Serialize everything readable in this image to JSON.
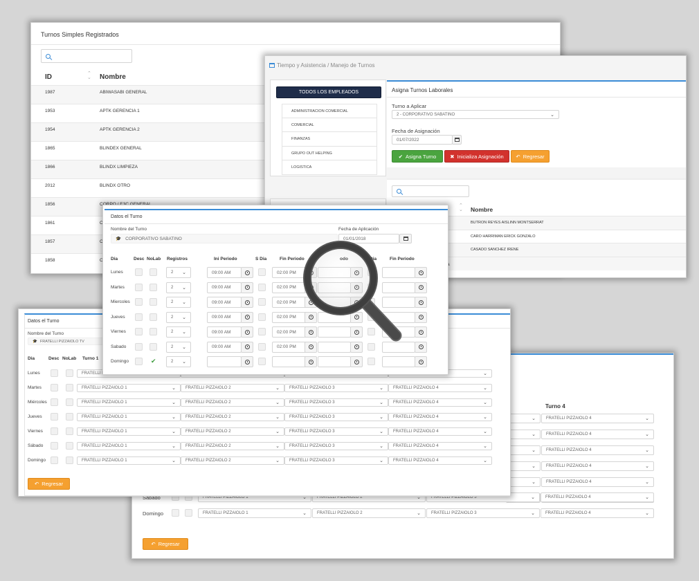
{
  "shifts_list": {
    "title": "Turnos Simples Registrados",
    "columns": {
      "id": "ID",
      "name": "Nombre"
    },
    "rows": [
      {
        "id": "1987",
        "name": "ABIWASABI GENERAL"
      },
      {
        "id": "1953",
        "name": "APTK GERENCIA 1"
      },
      {
        "id": "1954",
        "name": "APTK GERENCIA 2"
      },
      {
        "id": "1865",
        "name": "BLINDEX GENERAL"
      },
      {
        "id": "1866",
        "name": "BLINDX LIMPIEZA"
      },
      {
        "id": "2012",
        "name": "BLINDX OTRO"
      },
      {
        "id": "1856",
        "name": "CORPO / E3C GENERAL"
      },
      {
        "id": "1861",
        "name": "C"
      },
      {
        "id": "1857",
        "name": "C"
      },
      {
        "id": "1858",
        "name": "C"
      }
    ]
  },
  "assign": {
    "breadcrumb": "Tiempo y Asistencia / Manejo de Turnos",
    "all_employees": "TODOS LOS EMPLEADOS",
    "departments": [
      "ADMINISTRACION COMERCIAL",
      "COMERCIAL",
      "FINANZAS",
      "GRUPO OUT HELPING",
      "LOGISTICA"
    ],
    "panel_title": "Asigna Turnos Laborales",
    "turno_label": "Turno a Aplicar",
    "turno_value": "2 - CORPORATIVO SABATINO",
    "fecha_label": "Fecha de Asignación",
    "fecha_value": "01/07/2022",
    "btn_assign": "Asigna Turno",
    "btn_init": "Inicializa Asignación",
    "btn_back": "Regresar",
    "emp_column": "Nombre",
    "employees": [
      "BUTRON REYES AISLINN MONTSERRAT",
      "CARO HARRIMAN ERICK GONZALO",
      "CASADO SANCHEZ IRENE"
    ],
    "fragment": "a"
  },
  "shift_detail": {
    "title": "Datos el Turno",
    "name_label": "Nombre del Turno",
    "name_value": "CORPORATIVO SABATINO",
    "date_label": "Fecha de Aplicación",
    "date_value": "01/01/2018",
    "headers": {
      "day": "Dia",
      "desc": "Desc",
      "nolab": "NoLab",
      "reg": "Registros",
      "ini": "Ini Periodo",
      "sdia": "S Dia",
      "fin": "Fin Periodo",
      "odo": "odo",
      "dia2": "Dia",
      "fin2": "Fin Periodo"
    },
    "rows": [
      {
        "day": "Lunes",
        "reg": "2",
        "ini": "09:00 AM",
        "fin": "02:00 PM",
        "nolab": false
      },
      {
        "day": "Martes",
        "reg": "2",
        "ini": "09:00 AM",
        "fin": "02:00 PM",
        "nolab": false
      },
      {
        "day": "Miercoles",
        "reg": "2",
        "ini": "09:00 AM",
        "fin": "02:00 PM",
        "nolab": false
      },
      {
        "day": "Jueves",
        "reg": "2",
        "ini": "09:00 AM",
        "fin": "02:00 PM",
        "nolab": false
      },
      {
        "day": "Viernes",
        "reg": "2",
        "ini": "09:00 AM",
        "fin": "02:00 PM",
        "nolab": false
      },
      {
        "day": "Sabado",
        "reg": "2",
        "ini": "09:00 AM",
        "fin": "02:00 PM",
        "nolab": false
      },
      {
        "day": "Domingo",
        "reg": "2",
        "ini": "",
        "fin": "",
        "nolab": true
      }
    ]
  },
  "multi_shift": {
    "title": "Datos el Turno",
    "name_label": "Nombre del Turno",
    "name_value": "FRATELLI PIZZAIOLO TV",
    "headers": {
      "day": "Dia",
      "desc": "Desc",
      "nolab": "NoLab",
      "t1": "Turno 1"
    },
    "days": [
      "Lunes",
      "Martes",
      "Miércoles",
      "Jueves",
      "Viernes",
      "Sábado",
      "Domingo"
    ],
    "opts": [
      "FRATELLI PIZZAIOLO 1",
      "FRATELLI PIZZAIOLO 2",
      "FRATELLI PIZZAIOLO 3",
      "FRATELLI PIZZAIOLO 4"
    ],
    "btn_back": "Regresar"
  },
  "back_shift": {
    "turno4": "Turno 4",
    "opt4": "FRATELLI PIZZAIOLO 4",
    "opts": [
      "FRATELLI PIZZAIOLO 1",
      "FRATELLI PIZZAIOLO 2",
      "FRATELLI PIZZAIOLO 3",
      "FRATELLI PIZZAIOLO 4"
    ],
    "days": [
      "Sábado",
      "Domingo"
    ],
    "btn_back": "Regresar"
  },
  "colors": {
    "accent": "#3a8bd6",
    "navy": "#1f2d4a",
    "orange": "#f5a030",
    "green": "#4aa43f",
    "red": "#d2322d"
  },
  "icons": [
    "search-icon",
    "calendar-icon",
    "clock-icon",
    "check-icon",
    "times-icon",
    "reply-icon",
    "sort-icon",
    "magnifier-icon",
    "caret-down-icon"
  ]
}
